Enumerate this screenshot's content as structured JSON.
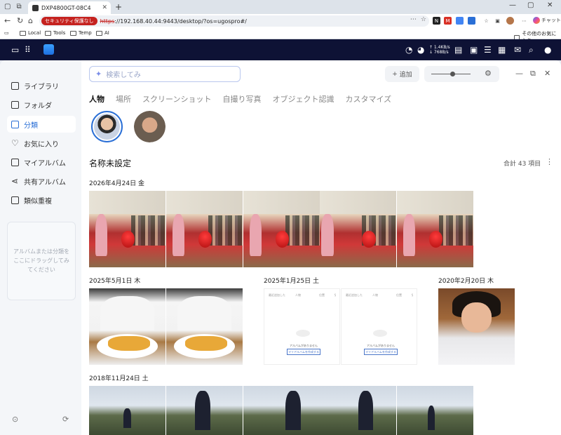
{
  "browser": {
    "tab_title": "DXP4800GT-08C4",
    "security_badge": "セキュリティ保護なし",
    "url_scheme": "https",
    "url_rest": "://192.168.40.44:9443/desktop/?os=ugospro#/",
    "copilot_label": "チャット",
    "bookmarks": [
      "Local",
      "Tools",
      "Temp",
      "AI"
    ],
    "other_bookmarks": "その他のお気に入り"
  },
  "nas": {
    "upload_speed": "↑ 1.4KB/s",
    "download_speed": "↓ 768B/s"
  },
  "sidebar": {
    "items": [
      {
        "label": "ライブラリ"
      },
      {
        "label": "フォルダ"
      },
      {
        "label": "分類"
      },
      {
        "label": "お気に入り"
      },
      {
        "label": "マイアルバム"
      },
      {
        "label": "共有アルバム"
      },
      {
        "label": "類似重複"
      }
    ],
    "dropzone_text": "アルバムまたは分類をここにドラッグしてみてください"
  },
  "toolbar": {
    "search_placeholder": "検索してみ",
    "add_label": "追加"
  },
  "tabs": [
    "人物",
    "場所",
    "スクリーンショット",
    "自撮り写真",
    "オブジェクト認識",
    "カスタマイズ"
  ],
  "album": {
    "title": "名称未設定",
    "total": "合計 43 項目"
  },
  "groups": [
    {
      "date": "2026年4月24日 金"
    },
    {
      "date": "2025年5月1日 木"
    },
    {
      "date": "2025年1月25日 土"
    },
    {
      "date": "2020年2月20日 木"
    },
    {
      "date": "2018年11月24日 土"
    }
  ],
  "screenshot_thumb": {
    "row_labels": [
      "最近追加した",
      "人物",
      "位置",
      "§"
    ],
    "message": "アルバムがありません",
    "button": "マイアルバムを作成する"
  }
}
